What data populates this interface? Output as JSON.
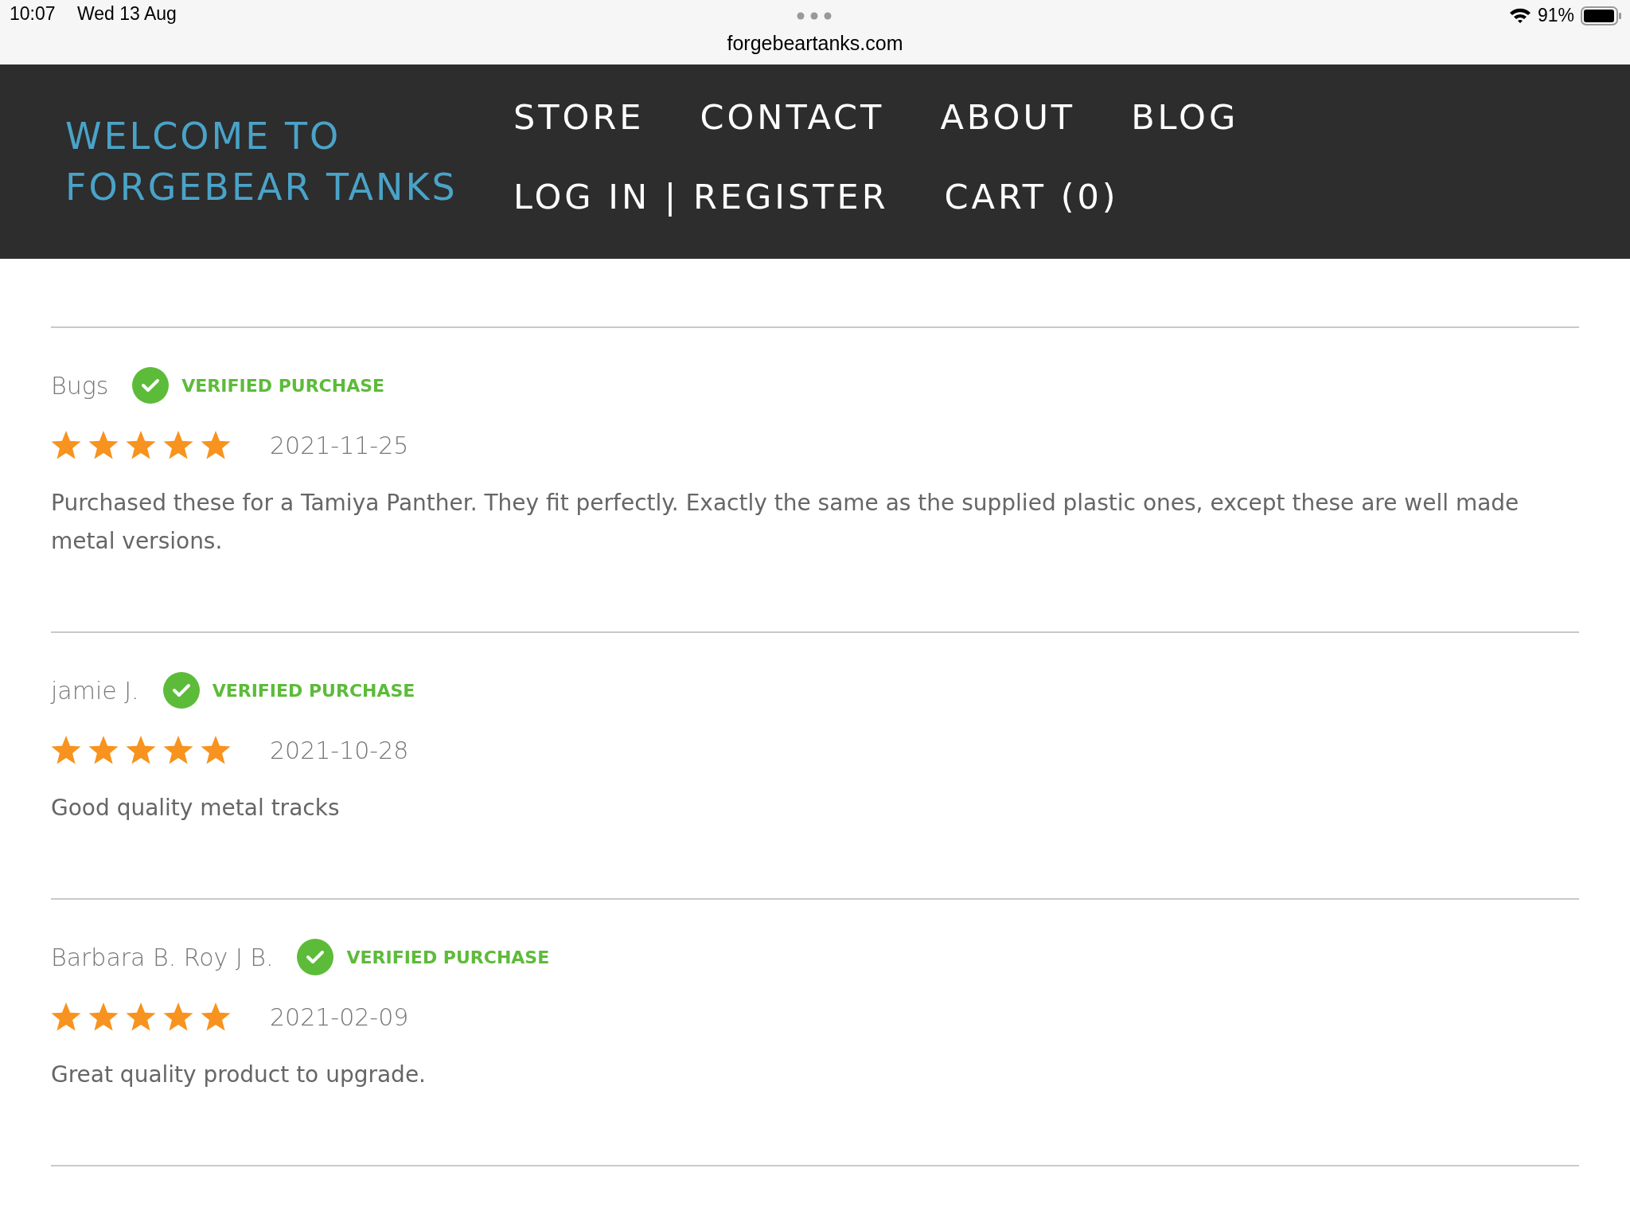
{
  "status_bar": {
    "time": "10:07",
    "date": "Wed 13 Aug",
    "url": "forgebeartanks.com",
    "battery": "91%"
  },
  "header": {
    "title_lines": [
      "WELCOME TO",
      "FORGEBEAR TANKS"
    ],
    "nav_rows": [
      {
        "items": [
          "STORE",
          "CONTACT",
          "ABOUT",
          "BLOG"
        ]
      },
      {
        "items": [
          "LOG IN | REGISTER",
          "CART (0)"
        ]
      }
    ]
  },
  "reviews": [
    {
      "name": "Bugs",
      "badge": "VERIFIED PURCHASE",
      "stars": 5,
      "date": "2021-11-25",
      "text": "Purchased these for a Tamiya Panther. They fit perfectly. Exactly the same as the supplied plastic ones, except these are well made metal versions."
    },
    {
      "name": "jamie J.",
      "badge": "VERIFIED PURCHASE",
      "stars": 5,
      "date": "2021-10-28",
      "text": "Good quality metal tracks"
    },
    {
      "name": "Barbara B. Roy J B.",
      "badge": "VERIFIED PURCHASE",
      "stars": 5,
      "date": "2021-02-09",
      "text": "Great quality product to upgrade."
    }
  ]
}
